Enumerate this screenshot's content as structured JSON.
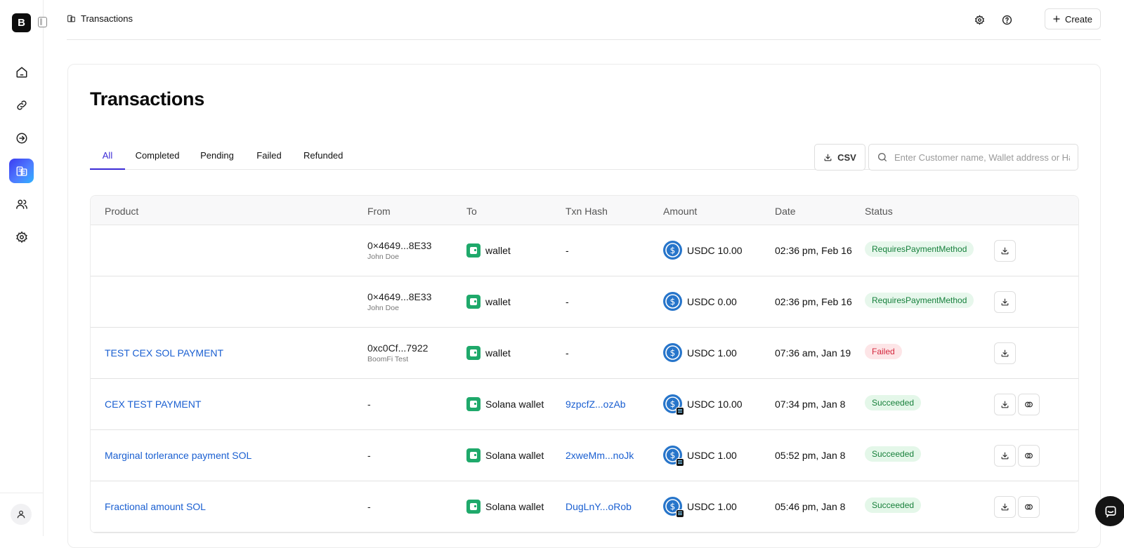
{
  "app": {
    "logo_text": "B"
  },
  "header": {
    "breadcrumb": "Transactions",
    "create_label": "Create"
  },
  "page": {
    "title": "Transactions"
  },
  "tabs": [
    {
      "label": "All",
      "active": true
    },
    {
      "label": "Completed",
      "active": false
    },
    {
      "label": "Pending",
      "active": false
    },
    {
      "label": "Failed",
      "active": false
    },
    {
      "label": "Refunded",
      "active": false
    }
  ],
  "toolbar": {
    "csv_label": "CSV",
    "search_placeholder": "Enter Customer name, Wallet address or Hash"
  },
  "table": {
    "columns": [
      "Product",
      "From",
      "To",
      "Txn Hash",
      "Amount",
      "Date",
      "Status"
    ],
    "rows": [
      {
        "product": "",
        "from_address": "0×4649...8E33",
        "from_name": "John Doe",
        "to": "wallet",
        "hash": "-",
        "amount": "USDC 10.00",
        "date": "02:36 pm, Feb 16",
        "status": "RequiresPaymentMethod"
      },
      {
        "product": "",
        "from_address": "0×4649...8E33",
        "from_name": "John Doe",
        "to": "wallet",
        "hash": "-",
        "amount": "USDC 0.00",
        "date": "02:36 pm, Feb 16",
        "status": "RequiresPaymentMethod"
      },
      {
        "product": "TEST CEX SOL PAYMENT",
        "from_address": "0xc0Cf...7922",
        "from_name": "BoomFi Test",
        "to": "wallet",
        "hash": "-",
        "amount": "USDC 1.00",
        "date": "07:36 am, Jan 19",
        "status": "Failed"
      },
      {
        "product": "CEX TEST PAYMENT",
        "from_address": "-",
        "from_name": "",
        "to": "Solana wallet",
        "hash": "9zpcfZ...ozAb",
        "amount": "USDC 10.00",
        "date": "07:34 pm, Jan 8",
        "status": "Succeeded"
      },
      {
        "product": "Marginal torlerance payment SOL",
        "from_address": "-",
        "from_name": "",
        "to": "Solana wallet",
        "hash": "2xweMm...noJk",
        "amount": "USDC 1.00",
        "date": "05:52 pm, Jan 8",
        "status": "Succeeded"
      },
      {
        "product": "Fractional amount SOL",
        "from_address": "-",
        "from_name": "",
        "to": "Solana wallet",
        "hash": "DugLnY...oRob",
        "amount": "USDC 1.00",
        "date": "05:46 pm, Jan 8",
        "status": "Succeeded"
      }
    ]
  },
  "colors": {
    "accent": "#3b2bd6",
    "link": "#1a5fd1",
    "usdc": "#2775ca",
    "wallet": "#1fa96b",
    "success_bg": "#e4f7e9",
    "fail_bg": "#fde5e7"
  },
  "icons": {
    "sidebar": [
      "home-icon",
      "link-icon",
      "login-icon",
      "transactions-icon",
      "users-icon",
      "settings-icon"
    ],
    "header": [
      "settings-icon",
      "help-icon",
      "plus-icon"
    ]
  }
}
